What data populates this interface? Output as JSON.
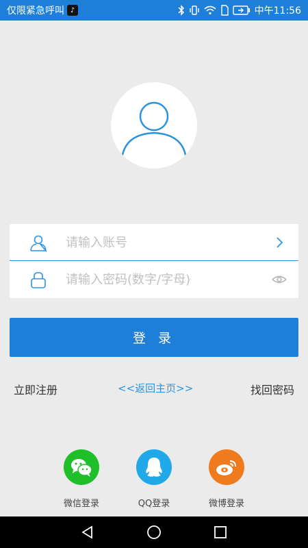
{
  "status_bar": {
    "carrier": "仅限紧急呼叫",
    "time": "中午11:56"
  },
  "form": {
    "account_placeholder": "请输入账号",
    "password_placeholder": "请输入密码(数字/字母)"
  },
  "login_button": "登 录",
  "links": {
    "register": "立即注册",
    "home": "<<返回主页>>",
    "forgot": "找回密码"
  },
  "social": {
    "wechat": "微信登录",
    "qq": "QQ登录",
    "weibo": "微博登录"
  },
  "colors": {
    "primary": "#1e7fd9",
    "wechat": "#1fbf2a",
    "qq": "#20a8e8",
    "weibo": "#f07a1e"
  }
}
